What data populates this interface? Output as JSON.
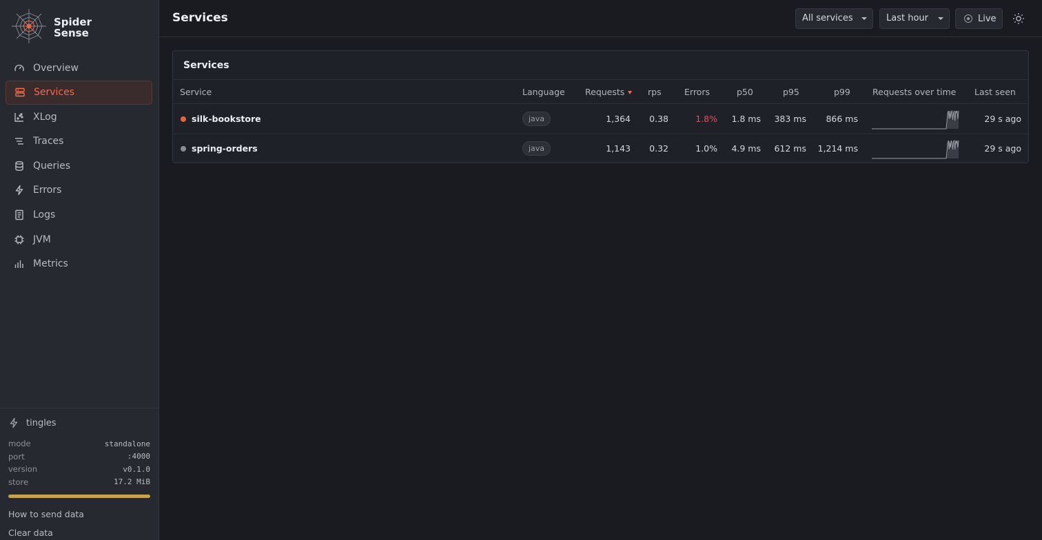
{
  "brand": {
    "name_line1": "Spider",
    "name_line2": "Sense"
  },
  "sidebar": {
    "items": [
      {
        "label": "Overview",
        "icon": "gauge-icon",
        "active": false
      },
      {
        "label": "Services",
        "icon": "server-icon",
        "active": true
      },
      {
        "label": "XLog",
        "icon": "scatter-chart-icon",
        "active": false
      },
      {
        "label": "Traces",
        "icon": "traces-icon",
        "active": false
      },
      {
        "label": "Queries",
        "icon": "database-icon",
        "active": false
      },
      {
        "label": "Errors",
        "icon": "bolt-icon",
        "active": false
      },
      {
        "label": "Logs",
        "icon": "document-icon",
        "active": false
      },
      {
        "label": "JVM",
        "icon": "chip-icon",
        "active": false
      },
      {
        "label": "Metrics",
        "icon": "bar-chart-icon",
        "active": false
      }
    ],
    "footer": {
      "name": "tingles",
      "mode_label": "mode",
      "mode_value": "standalone",
      "port_label": "port",
      "port_value": ":4000",
      "version_label": "version",
      "version_value": "v0.1.0",
      "store_label": "store",
      "store_value": "17.2 MiB",
      "store_usage": 1.0,
      "link_send": "How to send data",
      "link_clear": "Clear data"
    }
  },
  "header": {
    "title": "Services",
    "service_filter": "All services",
    "time_range": "Last hour",
    "live_label": "Live"
  },
  "card": {
    "title": "Services",
    "columns": {
      "service": "Service",
      "language": "Language",
      "requests": "Requests",
      "rps": "rps",
      "errors": "Errors",
      "p50": "p50",
      "p95": "p95",
      "p99": "p99",
      "spark": "Requests over time",
      "last_seen": "Last seen"
    },
    "rows": [
      {
        "name": "silk-bookstore",
        "status_color": "#e8643f",
        "language": "java",
        "requests": "1,364",
        "rps": "0.38",
        "errors": "1.8%",
        "errors_color": "#e0525a",
        "p50": "1.8 ms",
        "p95": "383 ms",
        "p99": "866 ms",
        "last_seen": "29 s ago",
        "spark": [
          0,
          0,
          0,
          0,
          0,
          0,
          0,
          0,
          0,
          0,
          0,
          0,
          0,
          0,
          0,
          0,
          0,
          0,
          0,
          0,
          0,
          0,
          0,
          0,
          0,
          0,
          0,
          0,
          0,
          0,
          0,
          0,
          0,
          0,
          0,
          0,
          0,
          0,
          0,
          0,
          0,
          0,
          0,
          0,
          0,
          0,
          0,
          0,
          0,
          0,
          0,
          0,
          0,
          0,
          0,
          0,
          0,
          0,
          0,
          0,
          0,
          0,
          0,
          0,
          0,
          0,
          0,
          0,
          0,
          0,
          0,
          0,
          0,
          0,
          0,
          0,
          0,
          0,
          0,
          0,
          0,
          0,
          0,
          0,
          0,
          0,
          0,
          0,
          0,
          0,
          0,
          0,
          0,
          0,
          0,
          0,
          0,
          0,
          0,
          0,
          0,
          0,
          0,
          0.4,
          0.9,
          1.0,
          0.55,
          1.0,
          0.6,
          0.95,
          1.0,
          0.5,
          0.9,
          1.0,
          0.45,
          1.0,
          0.9,
          1.0,
          0.55,
          1.0
        ]
      },
      {
        "name": "spring-orders",
        "status_color": "#8a8d96",
        "language": "java",
        "requests": "1,143",
        "rps": "0.32",
        "errors": "1.0%",
        "errors_color": "#d6d8dd",
        "p50": "4.9 ms",
        "p95": "612 ms",
        "p99": "1,214 ms",
        "last_seen": "29 s ago",
        "spark": [
          0,
          0,
          0,
          0,
          0,
          0,
          0,
          0,
          0,
          0,
          0,
          0,
          0,
          0,
          0,
          0,
          0,
          0,
          0,
          0,
          0,
          0,
          0,
          0,
          0,
          0,
          0,
          0,
          0,
          0,
          0,
          0,
          0,
          0,
          0,
          0,
          0,
          0,
          0,
          0,
          0,
          0,
          0,
          0,
          0,
          0,
          0,
          0,
          0,
          0,
          0,
          0,
          0,
          0,
          0,
          0,
          0,
          0,
          0,
          0,
          0,
          0,
          0,
          0,
          0,
          0,
          0,
          0,
          0,
          0,
          0,
          0,
          0,
          0,
          0,
          0,
          0,
          0,
          0,
          0,
          0,
          0,
          0,
          0,
          0,
          0,
          0,
          0,
          0,
          0,
          0,
          0,
          0,
          0,
          0,
          0,
          0,
          0,
          0,
          0,
          0,
          0,
          0,
          0.4,
          0.85,
          1.0,
          0.5,
          0.95,
          0.6,
          1.0,
          0.9,
          0.5,
          0.95,
          1.0,
          0.5,
          1.0,
          0.85,
          1.0,
          0.6,
          1.0
        ]
      }
    ]
  }
}
